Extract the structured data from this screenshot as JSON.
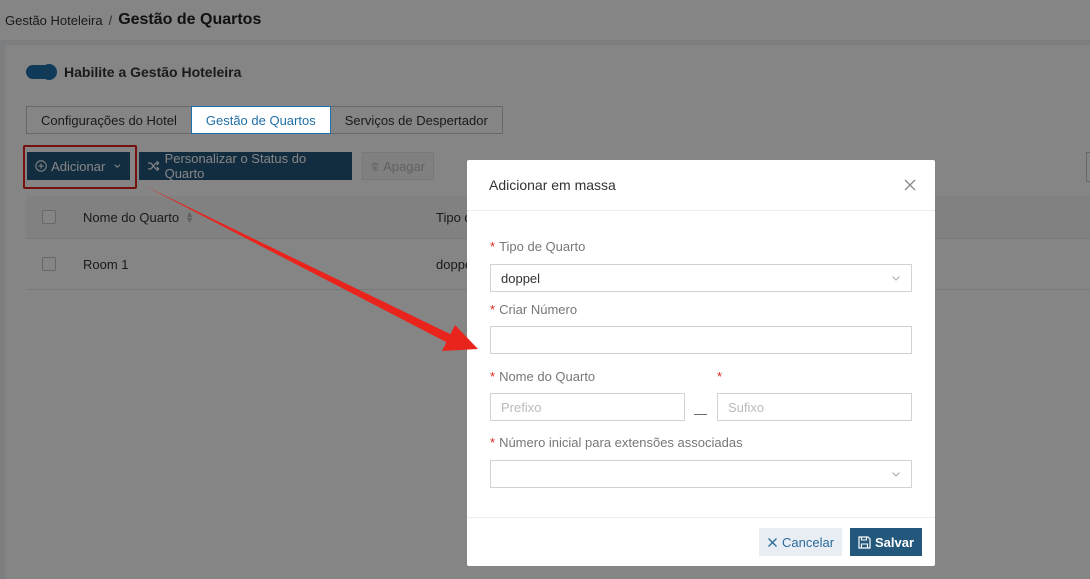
{
  "breadcrumb": {
    "root": "Gestão Hoteleira",
    "separator": "/",
    "current": "Gestão de Quartos"
  },
  "toggle": {
    "label": "Habilite a Gestão Hoteleira",
    "enabled": true
  },
  "tabs": [
    {
      "label": "Configurações do Hotel",
      "active": false
    },
    {
      "label": "Gestão de Quartos",
      "active": true
    },
    {
      "label": "Serviços de Despertador",
      "active": false
    }
  ],
  "toolbar": {
    "add_label": "Adicionar",
    "custom_status_label": "Personalizar o Status do Quarto",
    "delete_label": "Apagar"
  },
  "table": {
    "columns": [
      "Nome do Quarto",
      "Tipo d"
    ],
    "rows": [
      {
        "name": "Room 1",
        "type": "doppe"
      }
    ]
  },
  "modal": {
    "title": "Adicionar em massa",
    "room_type_label": "Tipo de Quarto",
    "room_type_value": "doppel",
    "create_number_label": "Criar Número",
    "create_number_value": "",
    "room_name_label": "Nome do Quarto",
    "prefix_placeholder": "Prefixo",
    "range_separator": "—",
    "suffix_placeholder": "Sufixo",
    "extension_label": "Número inicial para extensões associadas",
    "extension_value": "",
    "required_mark": "*",
    "cancel_label": "Cancelar",
    "save_label": "Salvar"
  },
  "colors": {
    "primary": "#23577c",
    "accent": "#1f6fa8",
    "annotation": "#e02020",
    "required": "#d9281e"
  }
}
